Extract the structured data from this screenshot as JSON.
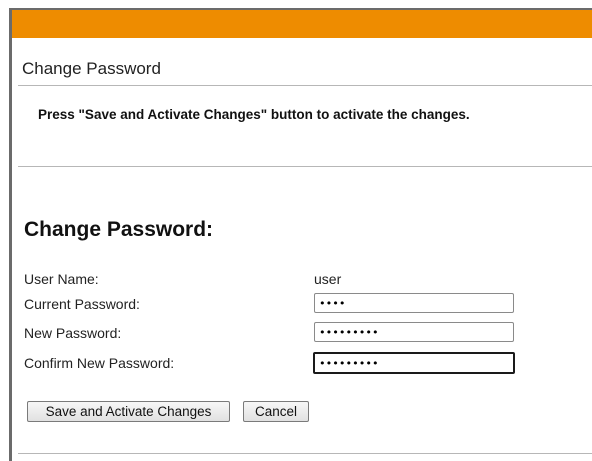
{
  "header": {
    "accent_color": "#ee8c00"
  },
  "section": {
    "title": "Change Password"
  },
  "notice": {
    "text": "Press \"Save and Activate Changes\" button to activate the changes."
  },
  "form": {
    "heading": "Change Password:",
    "user_name_label": "User Name:",
    "user_name_value": "user",
    "current_password_label": "Current Password:",
    "current_password_value": "••••",
    "new_password_label": "New Password:",
    "new_password_value": "•••••••••",
    "confirm_password_label": "Confirm New Password:",
    "confirm_password_value": "•••••••••"
  },
  "buttons": {
    "save_label": "Save and Activate Changes",
    "cancel_label": "Cancel"
  }
}
